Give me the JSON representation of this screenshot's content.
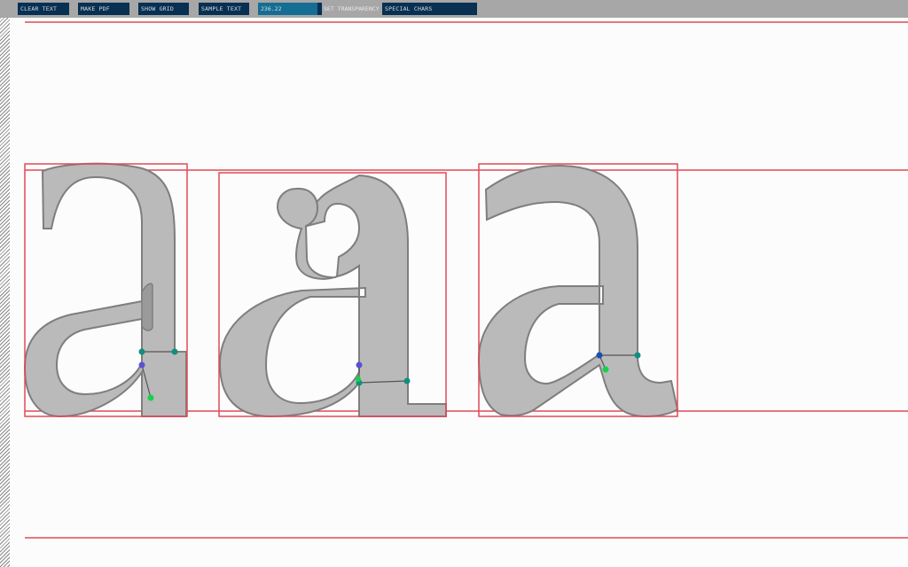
{
  "toolbar": {
    "buttons": [
      "CLEAR TEXT",
      "MAKE PDF",
      "SHOW GRID",
      "SAMPLE TEXT"
    ],
    "transparency_value": "236.22",
    "transparency_fraction": 0.93,
    "transparency_label": "SET TRANSPARENCY",
    "special_chars_label": "SPECIAL CHARS"
  },
  "colors": {
    "toolbar_bg": "#a7a7a7",
    "button_bg": "#073052",
    "slider_fill": "#156d93",
    "guide_line": "#e04a5a",
    "glyph_fill": "#bababa",
    "glyph_stroke": "#7e7e7e",
    "handle_teal": "#0f8f7e",
    "handle_purple": "#5b4fd6",
    "handle_green": "#17d14a",
    "handle_blue": "#1a4fb0"
  },
  "glyphs": [
    "a",
    "a",
    "a"
  ]
}
